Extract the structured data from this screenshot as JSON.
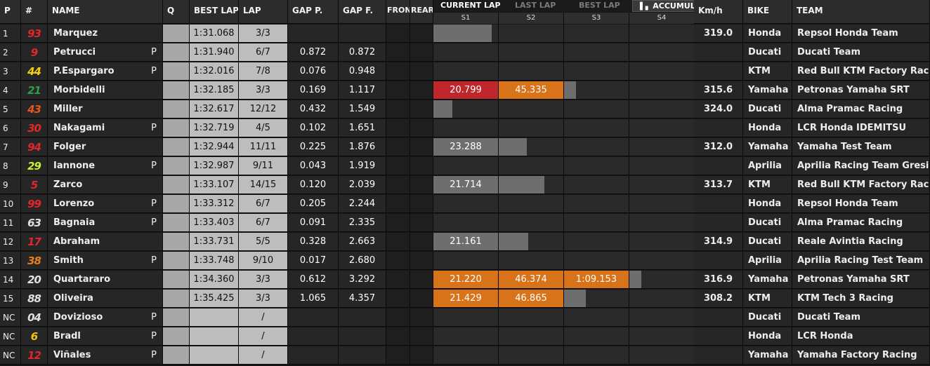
{
  "headers": {
    "p": "P",
    "num": "#",
    "name": "NAME",
    "q": "Q",
    "best": "BEST LAP",
    "lap": "LAP",
    "gap_p": "GAP P.",
    "gap_f": "GAP F.",
    "front": "FRONT",
    "rear": "REAR",
    "kmh": "Km/h",
    "bike": "BIKE",
    "team": "TEAM"
  },
  "tabs": {
    "current": "CURRENT LAP",
    "last": "LAST LAP",
    "best": "BEST LAP",
    "accumulated": "ACCUMULATED",
    "accumulated_icon": "bar-chart-icon",
    "dropdown_icon": "chevron-down-icon"
  },
  "sectors": [
    "S1",
    "S2",
    "S3",
    "S4"
  ],
  "colors": {
    "red": "#c0272d",
    "orange": "#d9731a",
    "grey": "#6e6e6e"
  },
  "rows": [
    {
      "p": "1",
      "num": "93",
      "num_color": "#e3262b",
      "name": "Marquez",
      "pit": "",
      "best": "1:31.068",
      "lap": "3/3",
      "gap_p": "",
      "gap_f": "",
      "s": [
        "",
        "",
        "",
        ""
      ],
      "sc": [
        "grey",
        "",
        "",
        ""
      ],
      "sp": [
        0.9,
        0,
        0,
        0
      ],
      "kmh": "319.0",
      "bike": "Honda",
      "team": "Repsol Honda Team"
    },
    {
      "p": "2",
      "num": "9",
      "num_color": "#e3262b",
      "name": "Petrucci",
      "pit": "P",
      "best": "1:31.940",
      "lap": "6/7",
      "gap_p": "0.872",
      "gap_f": "0.872",
      "s": [
        "",
        "",
        "",
        ""
      ],
      "sc": [
        "",
        "",
        "",
        ""
      ],
      "sp": [
        0,
        0,
        0,
        0
      ],
      "kmh": "",
      "bike": "Ducati",
      "team": "Ducati Team"
    },
    {
      "p": "3",
      "num": "44",
      "num_color": "#f2d20f",
      "name": "P.Espargaro",
      "pit": "P",
      "best": "1:32.016",
      "lap": "7/8",
      "gap_p": "0.076",
      "gap_f": "0.948",
      "s": [
        "",
        "",
        "",
        ""
      ],
      "sc": [
        "",
        "",
        "",
        ""
      ],
      "sp": [
        0,
        0,
        0,
        0
      ],
      "kmh": "",
      "bike": "KTM",
      "team": "Red Bull KTM Factory Racing"
    },
    {
      "p": "4",
      "num": "21",
      "num_color": "#2f9e44",
      "name": "Morbidelli",
      "pit": "",
      "best": "1:32.185",
      "lap": "3/3",
      "gap_p": "0.169",
      "gap_f": "1.117",
      "s": [
        "20.799",
        "45.335",
        "",
        ""
      ],
      "sc": [
        "red",
        "orange",
        "grey",
        ""
      ],
      "sp": [
        1,
        1,
        0.18,
        0
      ],
      "kmh": "315.6",
      "bike": "Yamaha",
      "team": "Petronas Yamaha SRT"
    },
    {
      "p": "5",
      "num": "43",
      "num_color": "#e8541e",
      "name": "Miller",
      "pit": "",
      "best": "1:32.617",
      "lap": "12/12",
      "gap_p": "0.432",
      "gap_f": "1.549",
      "s": [
        "",
        "",
        "",
        ""
      ],
      "sc": [
        "grey",
        "",
        "",
        ""
      ],
      "sp": [
        0.29,
        0,
        0,
        0
      ],
      "kmh": "324.0",
      "bike": "Ducati",
      "team": "Alma Pramac Racing"
    },
    {
      "p": "6",
      "num": "30",
      "num_color": "#e3262b",
      "name": "Nakagami",
      "pit": "P",
      "best": "1:32.719",
      "lap": "4/5",
      "gap_p": "0.102",
      "gap_f": "1.651",
      "s": [
        "",
        "",
        "",
        ""
      ],
      "sc": [
        "",
        "",
        "",
        ""
      ],
      "sp": [
        0,
        0,
        0,
        0
      ],
      "kmh": "",
      "bike": "Honda",
      "team": "LCR Honda IDEMITSU"
    },
    {
      "p": "7",
      "num": "94",
      "num_color": "#e3262b",
      "name": "Folger",
      "pit": "",
      "best": "1:32.944",
      "lap": "11/11",
      "gap_p": "0.225",
      "gap_f": "1.876",
      "s": [
        "23.288",
        "",
        "",
        ""
      ],
      "sc": [
        "grey",
        "grey",
        "",
        ""
      ],
      "sp": [
        1,
        0.43,
        0,
        0
      ],
      "kmh": "312.0",
      "bike": "Yamaha",
      "team": "Yamaha Test Team"
    },
    {
      "p": "8",
      "num": "29",
      "num_color": "#c6f032",
      "name": "Iannone",
      "pit": "P",
      "best": "1:32.987",
      "lap": "9/11",
      "gap_p": "0.043",
      "gap_f": "1.919",
      "s": [
        "",
        "",
        "",
        ""
      ],
      "sc": [
        "",
        "",
        "",
        ""
      ],
      "sp": [
        0,
        0,
        0,
        0
      ],
      "kmh": "",
      "bike": "Aprilia",
      "team": "Aprilia Racing Team Gresini"
    },
    {
      "p": "9",
      "num": "5",
      "num_color": "#e3262b",
      "name": "Zarco",
      "pit": "",
      "best": "1:33.107",
      "lap": "14/15",
      "gap_p": "0.120",
      "gap_f": "2.039",
      "s": [
        "21.714",
        "",
        "",
        ""
      ],
      "sc": [
        "grey",
        "grey",
        "",
        ""
      ],
      "sp": [
        1,
        0.71,
        0,
        0
      ],
      "kmh": "313.7",
      "bike": "KTM",
      "team": "Red Bull KTM Factory Racing"
    },
    {
      "p": "10",
      "num": "99",
      "num_color": "#e3262b",
      "name": "Lorenzo",
      "pit": "P",
      "best": "1:33.312",
      "lap": "6/7",
      "gap_p": "0.205",
      "gap_f": "2.244",
      "s": [
        "",
        "",
        "",
        ""
      ],
      "sc": [
        "",
        "",
        "",
        ""
      ],
      "sp": [
        0,
        0,
        0,
        0
      ],
      "kmh": "",
      "bike": "Honda",
      "team": "Repsol Honda Team"
    },
    {
      "p": "11",
      "num": "63",
      "num_color": "#e0e0e0",
      "name": "Bagnaia",
      "pit": "P",
      "best": "1:33.403",
      "lap": "6/7",
      "gap_p": "0.091",
      "gap_f": "2.335",
      "s": [
        "",
        "",
        "",
        ""
      ],
      "sc": [
        "",
        "",
        "",
        ""
      ],
      "sp": [
        0,
        0,
        0,
        0
      ],
      "kmh": "",
      "bike": "Ducati",
      "team": "Alma Pramac Racing"
    },
    {
      "p": "12",
      "num": "17",
      "num_color": "#e3262b",
      "name": "Abraham",
      "pit": "",
      "best": "1:33.731",
      "lap": "5/5",
      "gap_p": "0.328",
      "gap_f": "2.663",
      "s": [
        "21.161",
        "",
        "",
        ""
      ],
      "sc": [
        "grey",
        "grey",
        "",
        ""
      ],
      "sp": [
        1,
        0.46,
        0,
        0
      ],
      "kmh": "314.9",
      "bike": "Ducati",
      "team": "Reale Avintia Racing"
    },
    {
      "p": "13",
      "num": "38",
      "num_color": "#e8801e",
      "name": "Smith",
      "pit": "P",
      "best": "1:33.748",
      "lap": "9/10",
      "gap_p": "0.017",
      "gap_f": "2.680",
      "s": [
        "",
        "",
        "",
        ""
      ],
      "sc": [
        "",
        "",
        "",
        ""
      ],
      "sp": [
        0,
        0,
        0,
        0
      ],
      "kmh": "",
      "bike": "Aprilia",
      "team": "Aprilia Racing Test Team"
    },
    {
      "p": "14",
      "num": "20",
      "num_color": "#e0e0e0",
      "name": "Quartararo",
      "pit": "",
      "best": "1:34.360",
      "lap": "3/3",
      "gap_p": "0.612",
      "gap_f": "3.292",
      "s": [
        "21.220",
        "46.374",
        "1:09.153",
        ""
      ],
      "sc": [
        "orange",
        "orange",
        "orange",
        "grey"
      ],
      "sp": [
        1,
        1,
        1,
        0.18
      ],
      "kmh": "316.9",
      "bike": "Yamaha",
      "team": "Petronas Yamaha SRT"
    },
    {
      "p": "15",
      "num": "88",
      "num_color": "#e0e0e0",
      "name": "Oliveira",
      "pit": "",
      "best": "1:35.425",
      "lap": "3/3",
      "gap_p": "1.065",
      "gap_f": "4.357",
      "s": [
        "21.429",
        "46.865",
        "",
        ""
      ],
      "sc": [
        "orange",
        "orange",
        "grey",
        ""
      ],
      "sp": [
        1,
        1,
        0.34,
        0
      ],
      "kmh": "308.2",
      "bike": "KTM",
      "team": "KTM Tech 3 Racing"
    },
    {
      "p": "NC",
      "num": "04",
      "num_color": "#e0e0e0",
      "name": "Dovizioso",
      "pit": "P",
      "best": "",
      "lap": "/",
      "gap_p": "",
      "gap_f": "",
      "s": [
        "",
        "",
        "",
        ""
      ],
      "sc": [
        "",
        "",
        "",
        ""
      ],
      "sp": [
        0,
        0,
        0,
        0
      ],
      "kmh": "",
      "bike": "Ducati",
      "team": "Ducati Team"
    },
    {
      "p": "NC",
      "num": "6",
      "num_color": "#f2c21f",
      "name": "Bradl",
      "pit": "P",
      "best": "",
      "lap": "/",
      "gap_p": "",
      "gap_f": "",
      "s": [
        "",
        "",
        "",
        ""
      ],
      "sc": [
        "",
        "",
        "",
        ""
      ],
      "sp": [
        0,
        0,
        0,
        0
      ],
      "kmh": "",
      "bike": "Honda",
      "team": "LCR Honda"
    },
    {
      "p": "NC",
      "num": "12",
      "num_color": "#e3262b",
      "name": "Viñales",
      "pit": "P",
      "best": "",
      "lap": "/",
      "gap_p": "",
      "gap_f": "",
      "s": [
        "",
        "",
        "",
        ""
      ],
      "sc": [
        "",
        "",
        "",
        ""
      ],
      "sp": [
        0,
        0,
        0,
        0
      ],
      "kmh": "",
      "bike": "Yamaha",
      "team": "Yamaha Factory Racing"
    }
  ]
}
